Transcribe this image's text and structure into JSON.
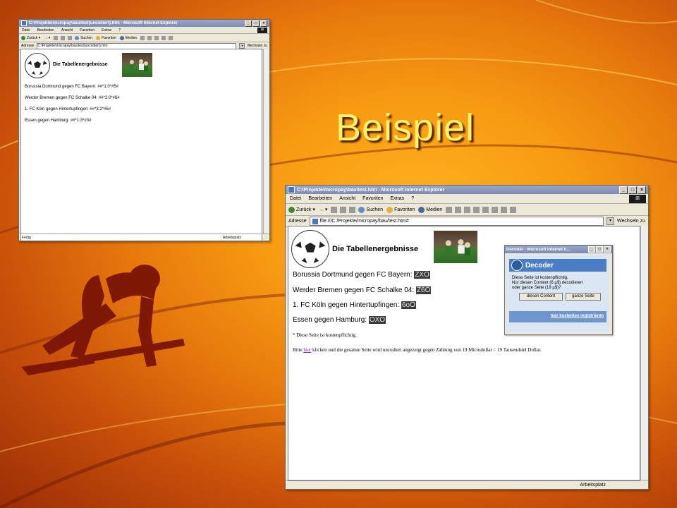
{
  "slide": {
    "title": "Beispiel"
  },
  "small_window": {
    "title": "C:\\Projekte\\micropay\\bau\\test(uncodiert).htm - Microsoft Internet Explorer",
    "menu": [
      "Datei",
      "Bearbeiten",
      "Ansicht",
      "Favoriten",
      "Extras",
      "?"
    ],
    "toolbar": {
      "back": "Zurück",
      "search": "Suchen",
      "favorites": "Favoriten",
      "media": "Medien"
    },
    "address_label": "Adresse",
    "address": "C:\\Projekte\\micropay\\bau\\test(uncodiert).htm",
    "go": "Wechseln zu",
    "page_title": "Die Tabellenergebnisse",
    "rows": [
      "Borussia Dortmund gegen FC Bayern: ##*1:0*#5#",
      "Werder Bremen gegen FC Schalke 04: ##*2:0*#6#",
      "1. FC Köln gegen Hintertupfingen: ##*3:2*#5#",
      "Essen gegen Hamburg: ##*1:3*#3#"
    ],
    "status_left": "Fertig",
    "status_right": "Arbeitsplatz"
  },
  "big_window": {
    "title": "C:\\Projekte\\micropay\\bau\\test.htm - Microsoft Internet Explorer",
    "menu": [
      "Datei",
      "Bearbeiten",
      "Ansicht",
      "Favoriten",
      "Extras",
      "?"
    ],
    "toolbar": {
      "back": "Zurück",
      "search": "Suchen",
      "favorites": "Favoriten",
      "media": "Medien"
    },
    "address_label": "Adresse",
    "address": "file:///C:/Projekte/micropay/bau/test.htm#",
    "go": "Wechseln zu",
    "page_title": "Die Tabellenergebnisse",
    "rows": [
      {
        "label": "Borussia Dortmund gegen FC Bayern:",
        "code": "ZXO"
      },
      {
        "label": "Werder Bremen gegen FC Schalke 04:",
        "code": "Z6O"
      },
      {
        "label": "1. FC Köln gegen Hintertupfingen:",
        "code": "6oO"
      },
      {
        "label": "Essen gegen Hamburg:",
        "code": "OXO"
      }
    ],
    "note": "* Diese Seite ist kostenpflichtig.",
    "bottom_before": "Bitte",
    "bottom_link": "hier",
    "bottom_after": "klicken und die gesamte Seite wird uncodiert angezeigt gegen Zahlung von 19 Microdollar = 19 Tausendstel Dollar.",
    "status_right": "Arbeitsplatz"
  },
  "decoder": {
    "title": "Decoder - Microsoft Internet E...",
    "heading": "Decoder",
    "line1": "Diese Seite ist kostenpflichtig.",
    "line2": "Nur diesen Content (6 µ$) decodieren",
    "line3": "oder ganze Seite (19 µ$)?",
    "btn_content": "diesen Content",
    "btn_page": "ganze Seite",
    "register_link": "hier kostenlos registrieren"
  }
}
